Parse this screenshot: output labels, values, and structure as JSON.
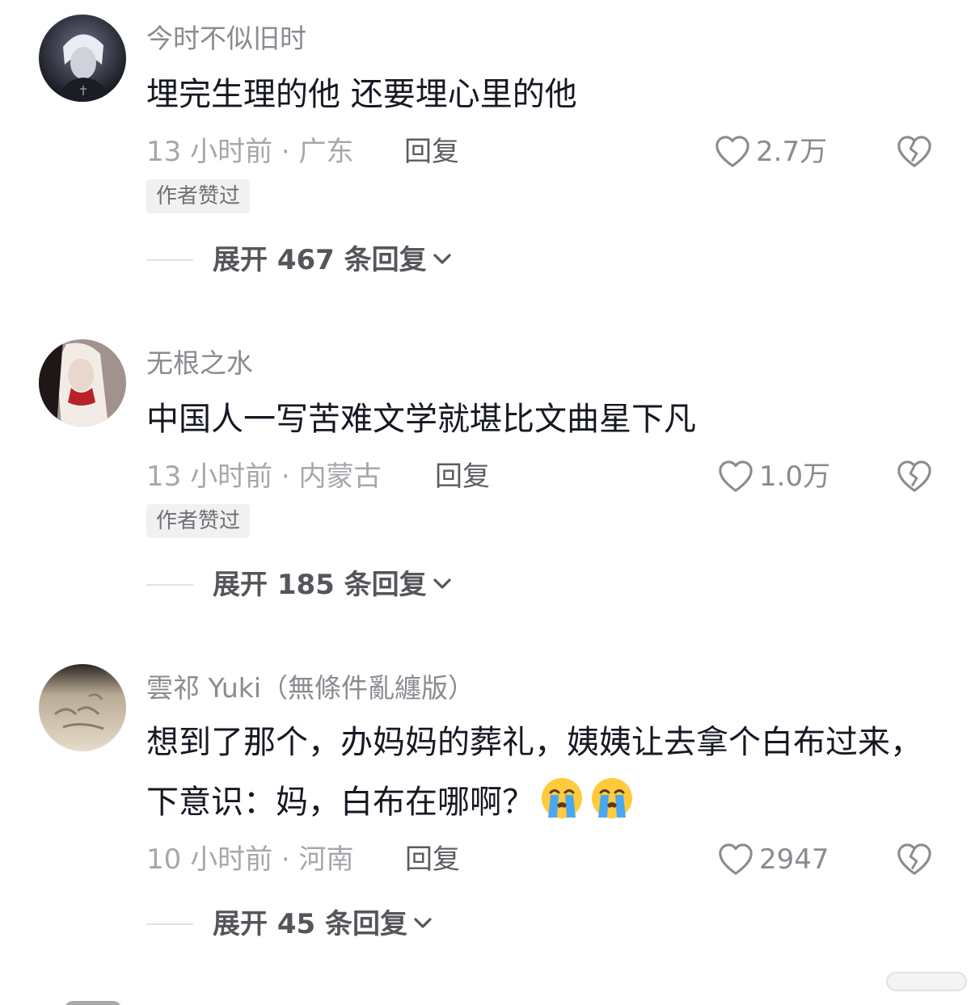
{
  "comments": [
    {
      "username": "今时不似旧时",
      "content": "埋完生理的他 还要埋心里的他",
      "meta": "13 小时前 · 广东",
      "reply_label": "回复",
      "likes": "2.7万",
      "badge": "作者赞过",
      "expand": "展开 467 条回复"
    },
    {
      "username": "无根之水",
      "content": "中国人一写苦难文学就堪比文曲星下凡",
      "meta": "13 小时前 · 内蒙古",
      "reply_label": "回复",
      "likes": "1.0万",
      "badge": "作者赞过",
      "expand": "展开 185 条回复"
    },
    {
      "username": "雲祁 Yuki（無條件亂纏版）",
      "content": "想到了那个，办妈妈的葬礼，姨姨让去拿个白布过来，下意识：妈，白布在哪啊？",
      "emoji": [
        "loudly-crying-face-emoji",
        "loudly-crying-face-emoji"
      ],
      "meta": "10 小时前 · 河南",
      "reply_label": "回复",
      "likes": "2947",
      "expand": "展开 45 条回复"
    }
  ],
  "icons": {
    "like": "heart-outline-icon",
    "dislike": "broken-heart-icon",
    "expand": "chevron-down-icon"
  },
  "colors": {
    "text_primary": "#161823",
    "text_secondary": "#8a8b91",
    "badge_bg": "#f1f1f2"
  }
}
